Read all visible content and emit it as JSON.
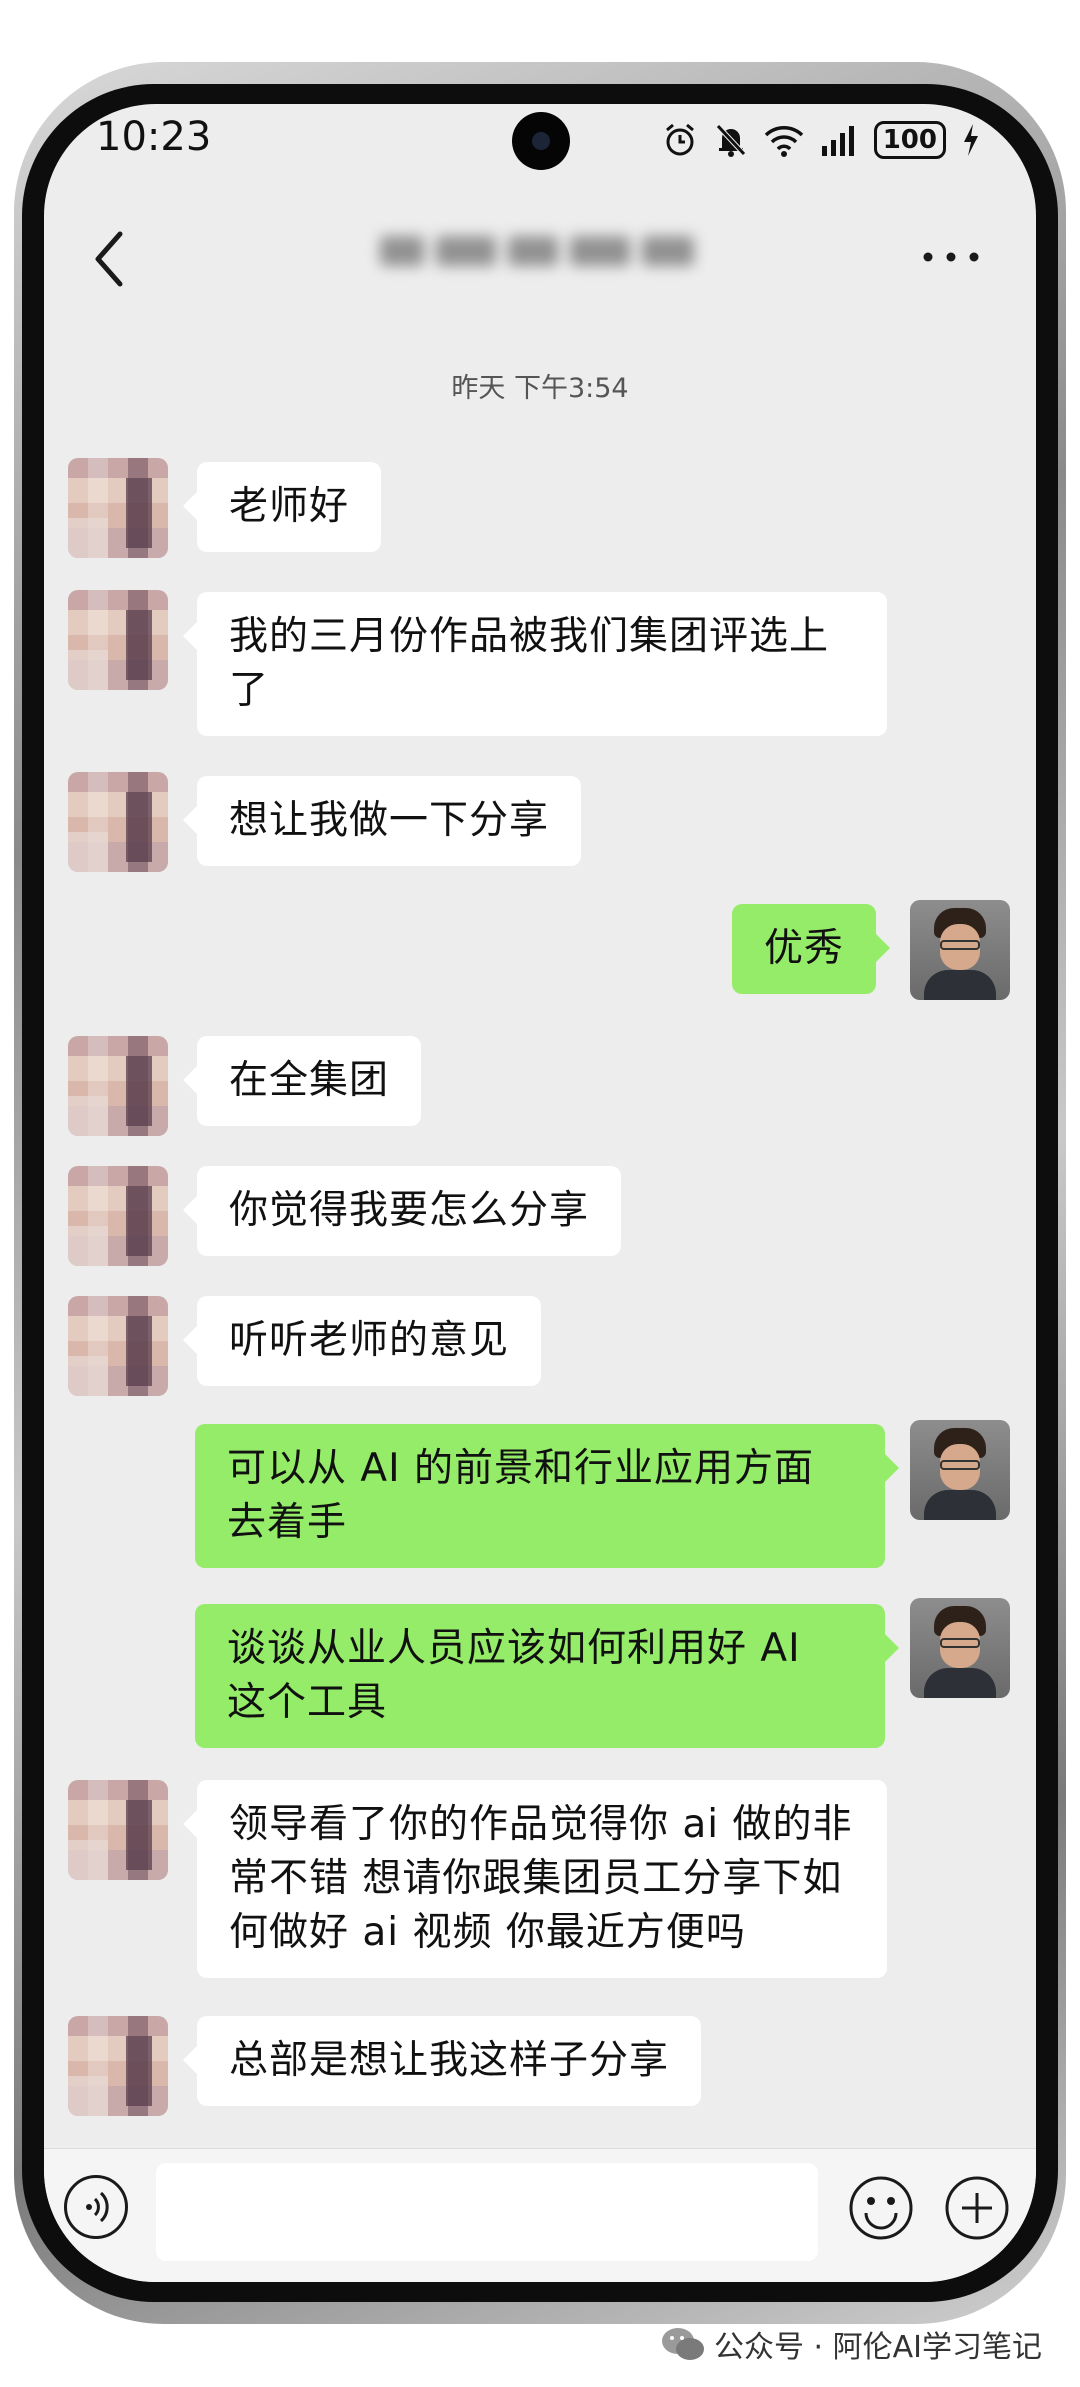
{
  "status_bar": {
    "time": "10:23",
    "battery": "100"
  },
  "header": {
    "title": ""
  },
  "timestamp": "昨天 下午3:54",
  "messages": [
    {
      "side": "in",
      "text": "老师好"
    },
    {
      "side": "in",
      "text": "我的三月份作品被我们集团评选上了"
    },
    {
      "side": "in",
      "text": "想让我做一下分享"
    },
    {
      "side": "out",
      "text": "优秀"
    },
    {
      "side": "in",
      "text": "在全集团"
    },
    {
      "side": "in",
      "text": "你觉得我要怎么分享"
    },
    {
      "side": "in",
      "text": "听听老师的意见"
    },
    {
      "side": "out",
      "text": "可以从 AI 的前景和行业应用方面去着手"
    },
    {
      "side": "out",
      "text": "谈谈从业人员应该如何利用好 AI 这个工具"
    },
    {
      "side": "in",
      "text": "领导看了你的作品觉得你 ai 做的非常不错   想请你跟集团员工分享下如何做好 ai 视频   你最近方便吗"
    },
    {
      "side": "in",
      "text": "总部是想让我这样子分享"
    }
  ],
  "input": {
    "value": "",
    "placeholder": ""
  },
  "watermark": {
    "text": "公众号 · 阿伦AI学习笔记"
  },
  "colors": {
    "out_bubble": "#95ec69",
    "in_bubble": "#ffffff",
    "chat_bg": "#ededed"
  },
  "icons": [
    "back-icon",
    "more-icon",
    "alarm-icon",
    "mute-icon",
    "wifi-icon",
    "signal-icon",
    "charging-icon",
    "voice-icon",
    "emoji-icon",
    "plus-icon",
    "wechat-icon"
  ]
}
